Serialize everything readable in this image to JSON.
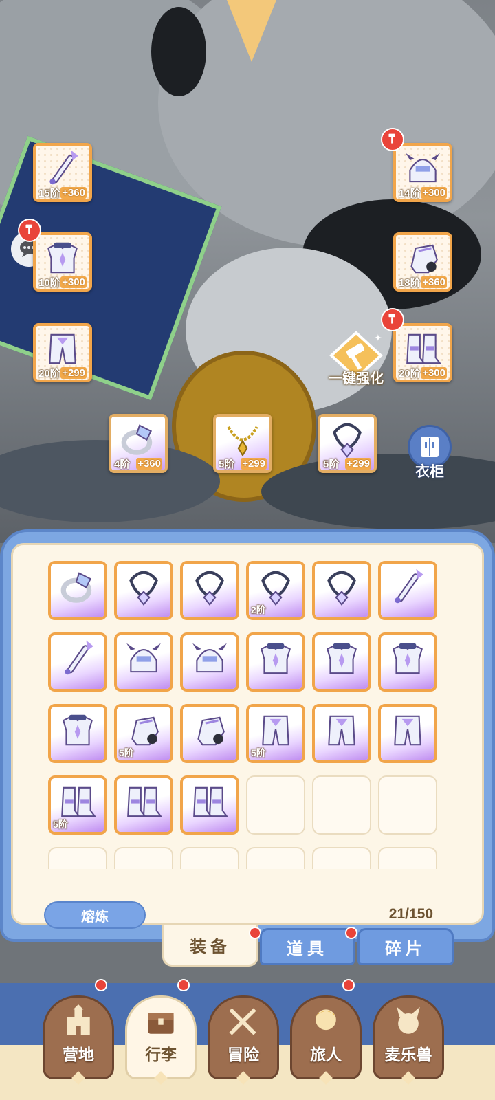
{
  "equipped": [
    {
      "name": "staff",
      "tier": "15阶",
      "plus": "+360",
      "hammer": false
    },
    {
      "name": "helmet",
      "tier": "14阶",
      "plus": "+300",
      "hammer": true
    },
    {
      "name": "armor",
      "tier": "10阶",
      "plus": "+300",
      "hammer": true
    },
    {
      "name": "gauntlet",
      "tier": "18阶",
      "plus": "+360",
      "hammer": false
    },
    {
      "name": "pants",
      "tier": "20阶",
      "plus": "+299",
      "hammer": false
    },
    {
      "name": "boots",
      "tier": "20阶",
      "plus": "+300",
      "hammer": true
    },
    {
      "name": "ring",
      "tier": "4阶",
      "plus": "+360",
      "hammer": false
    },
    {
      "name": "necklace",
      "tier": "5阶",
      "plus": "+299",
      "hammer": false
    },
    {
      "name": "amulet",
      "tier": "5阶",
      "plus": "+299",
      "hammer": false
    }
  ],
  "strengthen_label": "一键强化",
  "wardrobe_label": "衣柜",
  "bag": {
    "items": [
      {
        "icon": "ring-icon",
        "tier": ""
      },
      {
        "icon": "amulet-icon",
        "tier": ""
      },
      {
        "icon": "amulet-icon",
        "tier": ""
      },
      {
        "icon": "amulet-icon",
        "tier": "2阶"
      },
      {
        "icon": "amulet-icon",
        "tier": ""
      },
      {
        "icon": "staff-icon",
        "tier": ""
      },
      {
        "icon": "staff-icon",
        "tier": ""
      },
      {
        "icon": "helmet-icon",
        "tier": ""
      },
      {
        "icon": "helmet-icon",
        "tier": ""
      },
      {
        "icon": "armor-icon",
        "tier": ""
      },
      {
        "icon": "armor-icon",
        "tier": ""
      },
      {
        "icon": "armor-icon",
        "tier": ""
      },
      {
        "icon": "armor-icon",
        "tier": ""
      },
      {
        "icon": "gauntlet-icon",
        "tier": "5阶"
      },
      {
        "icon": "gauntlet-icon",
        "tier": ""
      },
      {
        "icon": "pants-icon",
        "tier": "5阶"
      },
      {
        "icon": "pants-icon",
        "tier": ""
      },
      {
        "icon": "pants-icon",
        "tier": ""
      },
      {
        "icon": "boots-icon",
        "tier": "5阶"
      },
      {
        "icon": "boots-icon",
        "tier": ""
      },
      {
        "icon": "boots-icon",
        "tier": ""
      }
    ],
    "smelt_label": "熔炼",
    "capacity": "21/150"
  },
  "tabs": [
    {
      "label": "装备",
      "active": true,
      "dot": true
    },
    {
      "label": "道具",
      "active": false,
      "dot": true
    },
    {
      "label": "碎片",
      "active": false,
      "dot": false
    }
  ],
  "nav": [
    {
      "label": "营地",
      "icon": "castle-icon",
      "active": false,
      "dot": true
    },
    {
      "label": "行李",
      "icon": "chest-icon",
      "active": true,
      "dot": true
    },
    {
      "label": "冒险",
      "icon": "swords-icon",
      "active": false,
      "dot": false
    },
    {
      "label": "旅人",
      "icon": "character-icon",
      "active": false,
      "dot": true
    },
    {
      "label": "麦乐兽",
      "icon": "pet-icon",
      "active": false,
      "dot": false
    }
  ],
  "colors": {
    "accent_orange": "#f1a54a",
    "accent_blue": "#7da7e2",
    "red_dot": "#e9443a",
    "purple_gear": "#bf8cf0"
  }
}
